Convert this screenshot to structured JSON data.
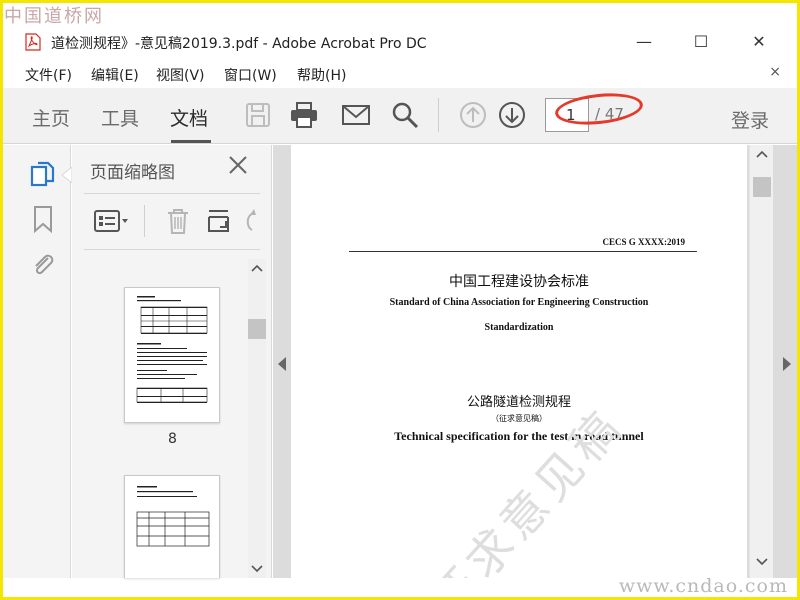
{
  "watermarks": {
    "top": "中国道桥网",
    "bottom": "www.cndao.com"
  },
  "window": {
    "title": "道检测规程》-意见稿2019.3.pdf - Adobe Acrobat Pro DC",
    "minimize": "—",
    "maximize": "☐",
    "close": "✕"
  },
  "menu": {
    "items": [
      "文件(F)",
      "编辑(E)",
      "视图(V)",
      "窗口(W)",
      "帮助(H)"
    ],
    "close": "×"
  },
  "toolbar": {
    "tabs": [
      "主页",
      "工具",
      "文档"
    ],
    "active_tab": "文档",
    "page_current": "1",
    "page_total": "/ 47",
    "login": "登录",
    "icons": [
      "save-icon",
      "print-icon",
      "email-icon",
      "search-icon",
      "page-up-icon",
      "page-down-icon"
    ]
  },
  "side_icons": [
    "page-thumbnails-icon",
    "bookmark-icon",
    "attachment-icon"
  ],
  "thumb_panel": {
    "title": "页面缩略图",
    "page_label": "8",
    "icons": [
      "thumbnail-options-icon",
      "delete-page-icon",
      "crop-page-icon",
      "rotate-page-icon"
    ]
  },
  "document": {
    "code": "CECS G XXXX:2019",
    "association_cn": "中国工程建设协会标准",
    "association_en_1": "Standard of China Association for Engineering Construction",
    "association_en_2": "Standardization",
    "title_cn": "公路隧道检测规程",
    "draft_cn": "（征求意见稿）",
    "title_en": "Technical specification for the test in road tunnel",
    "stamp": "征求意见稿"
  },
  "colors": {
    "accent_ellipse": "#e33a2a",
    "frame": "#f4e600",
    "pdf_red": "#d8261c"
  }
}
